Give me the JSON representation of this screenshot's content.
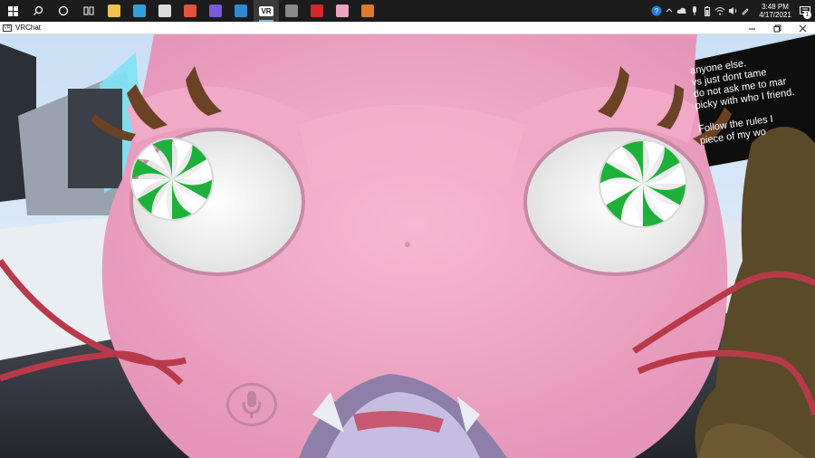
{
  "taskbar": {
    "apps": [
      {
        "name": "file-explorer",
        "color": "#f2c14e"
      },
      {
        "name": "edge",
        "color": "#2fa1e0"
      },
      {
        "name": "app-lightning",
        "color": "#dddddd"
      },
      {
        "name": "app-drop",
        "color": "#e0543a"
      },
      {
        "name": "app-gallery",
        "color": "#7a5bd6"
      },
      {
        "name": "app-blue",
        "color": "#2e8ad6"
      },
      {
        "name": "vrchat",
        "label": "VR",
        "color": "#ffffff"
      },
      {
        "name": "app-bug",
        "color": "#888888"
      },
      {
        "name": "app-red-face",
        "color": "#d12a2a"
      },
      {
        "name": "app-pink",
        "color": "#e8a4c0"
      },
      {
        "name": "app-orange",
        "color": "#e07a2a"
      }
    ],
    "clock_time": "3:48 PM",
    "clock_date": "4/17/2021",
    "notification_count": "1"
  },
  "window": {
    "title": "VRChat",
    "app_icon_label": "VR"
  },
  "scene": {
    "sign_lines": [
      "anyone else.",
      "vs just dont tame",
      "do not ask me to mar",
      "picky with who I friend.",
      "",
      "Follow the rules I",
      "piece of my wo"
    ]
  }
}
